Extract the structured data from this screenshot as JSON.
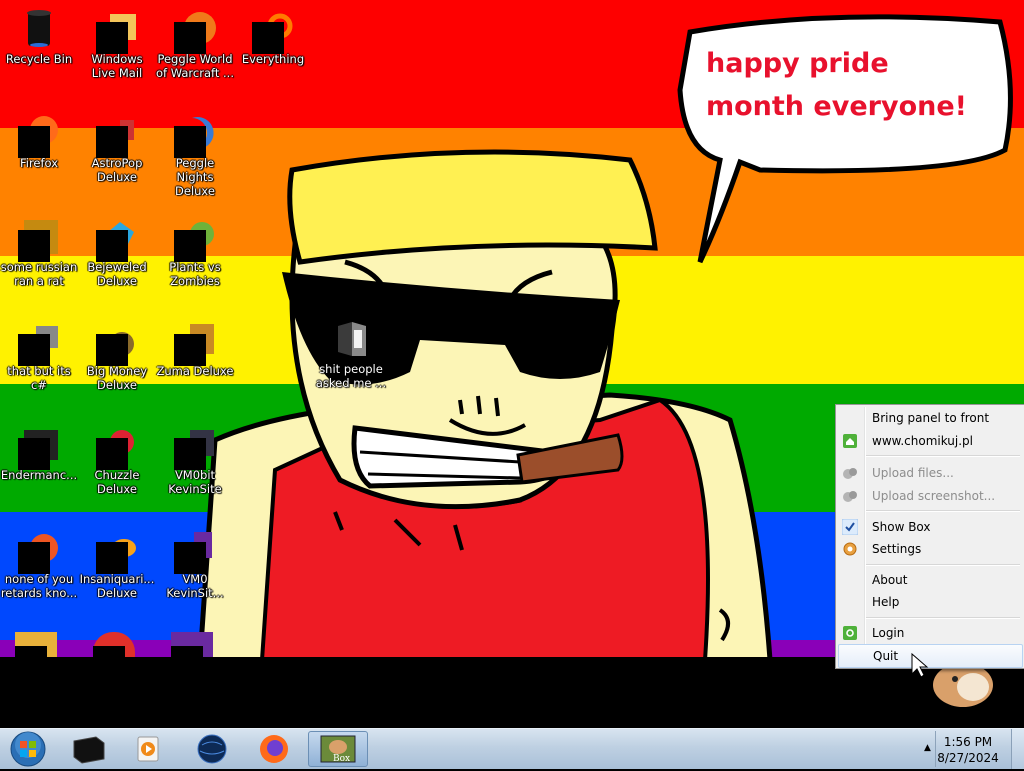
{
  "desktop_icons": [
    {
      "name": "Recycle Bin"
    },
    {
      "name": "Windows Live Mail"
    },
    {
      "name": "Peggle World of Warcraft ..."
    },
    {
      "name": "Everything"
    },
    {
      "name": "Firefox"
    },
    {
      "name": "AstroPop Deluxe"
    },
    {
      "name": "Peggle Nights Deluxe"
    },
    {
      "name": "some russian ran a rat"
    },
    {
      "name": "Bejeweled Deluxe"
    },
    {
      "name": "Plants vs Zombies"
    },
    {
      "name": "that but its c#"
    },
    {
      "name": "Big Money Deluxe"
    },
    {
      "name": "Zuma Deluxe"
    },
    {
      "name": "Endermanc..."
    },
    {
      "name": "Chuzzle Deluxe"
    },
    {
      "name": "VM0bit KevinSite"
    },
    {
      "name": "none of you retards kno..."
    },
    {
      "name": "Insaniquari... Deluxe"
    },
    {
      "name": "VM0 KevinSit..."
    },
    {
      "name": "shit people asked me ..."
    }
  ],
  "wallpaper": {
    "speech_bubble": "happy pride month everyone!",
    "stripe_colors": [
      "#fe0000",
      "#ff8200",
      "#fff200",
      "#00aa00",
      "#0048fe",
      "#8a00b8"
    ]
  },
  "context_menu": {
    "items": [
      {
        "label": "Bring panel to front",
        "icon": null,
        "enabled": true
      },
      {
        "label": "www.chomikuj.pl",
        "icon": "green-home-icon",
        "enabled": true
      },
      {
        "label": "Upload files...",
        "icon": "upload-icon",
        "enabled": false
      },
      {
        "label": "Upload screenshot...",
        "icon": "upload-icon",
        "enabled": false
      },
      {
        "label": "Show Box",
        "icon": "check-icon",
        "enabled": true,
        "checked": true
      },
      {
        "label": "Settings",
        "icon": "gear-icon",
        "enabled": true
      },
      {
        "label": "About",
        "icon": null,
        "enabled": true
      },
      {
        "label": "Help",
        "icon": null,
        "enabled": true
      },
      {
        "label": "Login",
        "icon": "green-login-icon",
        "enabled": true
      },
      {
        "label": "Quit",
        "icon": null,
        "enabled": true,
        "hovered": true
      }
    ]
  },
  "taskbar": {
    "start": "start-orb",
    "pinned": [
      "terminal-app",
      "media-player",
      "browser-globe",
      "firefox",
      "chomikbox"
    ],
    "active_app": "chomikbox",
    "active_label": "Box",
    "clock_time": "1:56 PM",
    "clock_date": "8/27/2024"
  }
}
